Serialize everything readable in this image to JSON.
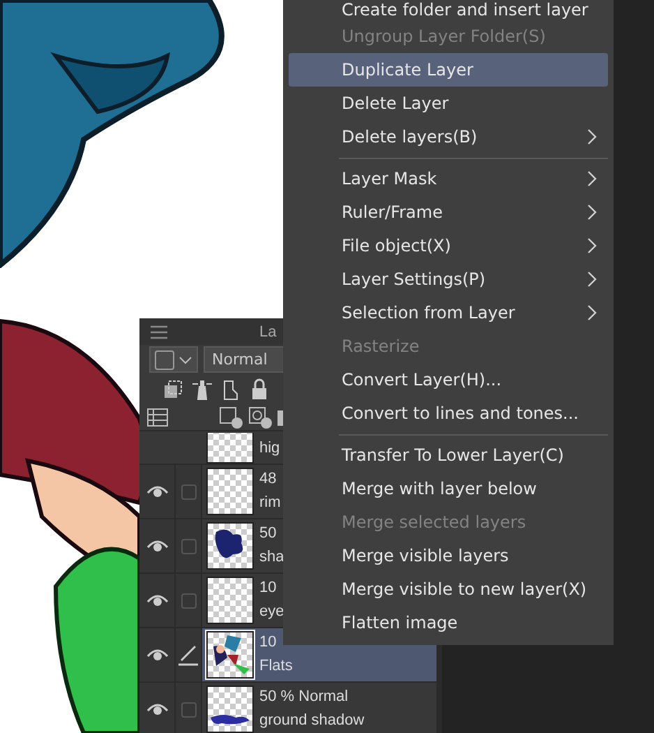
{
  "context_menu": {
    "items": [
      {
        "kind": "item",
        "label": "Create folder and insert layer",
        "disabled": false,
        "selected": false,
        "submenu": false
      },
      {
        "kind": "item",
        "label": "Ungroup Layer Folder(S)",
        "disabled": true,
        "selected": false,
        "submenu": false
      },
      {
        "kind": "item",
        "label": "Duplicate Layer",
        "disabled": false,
        "selected": true,
        "submenu": false
      },
      {
        "kind": "item",
        "label": "Delete Layer",
        "disabled": false,
        "selected": false,
        "submenu": false
      },
      {
        "kind": "item",
        "label": "Delete layers(B)",
        "disabled": false,
        "selected": false,
        "submenu": true
      },
      {
        "kind": "separator"
      },
      {
        "kind": "item",
        "label": "Layer Mask",
        "disabled": false,
        "selected": false,
        "submenu": true
      },
      {
        "kind": "item",
        "label": "Ruler/Frame",
        "disabled": false,
        "selected": false,
        "submenu": true
      },
      {
        "kind": "item",
        "label": "File object(X)",
        "disabled": false,
        "selected": false,
        "submenu": true
      },
      {
        "kind": "item",
        "label": "Layer Settings(P)",
        "disabled": false,
        "selected": false,
        "submenu": true
      },
      {
        "kind": "item",
        "label": "Selection from Layer",
        "disabled": false,
        "selected": false,
        "submenu": true
      },
      {
        "kind": "item",
        "label": "Rasterize",
        "disabled": true,
        "selected": false,
        "submenu": false
      },
      {
        "kind": "item",
        "label": "Convert Layer(H)...",
        "disabled": false,
        "selected": false,
        "submenu": false
      },
      {
        "kind": "item",
        "label": "Convert to lines and tones...",
        "disabled": false,
        "selected": false,
        "submenu": false
      },
      {
        "kind": "separator"
      },
      {
        "kind": "item",
        "label": "Transfer To Lower Layer(C)",
        "disabled": false,
        "selected": false,
        "submenu": false
      },
      {
        "kind": "item",
        "label": "Merge with layer below",
        "disabled": false,
        "selected": false,
        "submenu": false
      },
      {
        "kind": "item",
        "label": "Merge selected layers",
        "disabled": true,
        "selected": false,
        "submenu": false
      },
      {
        "kind": "item",
        "label": "Merge visible layers",
        "disabled": false,
        "selected": false,
        "submenu": false
      },
      {
        "kind": "item",
        "label": "Merge visible to new layer(X)",
        "disabled": false,
        "selected": false,
        "submenu": false
      },
      {
        "kind": "item",
        "label": "Flatten image",
        "disabled": false,
        "selected": false,
        "submenu": false
      }
    ]
  },
  "layer_panel": {
    "title": "La",
    "blend_mode": "Normal",
    "layers": [
      {
        "kind": "cut",
        "line2": "hig",
        "selected": false
      },
      {
        "kind": "blank",
        "line1": "48",
        "line2": "rim",
        "visible": true,
        "editing": false,
        "selected": false
      },
      {
        "kind": "shadow-art",
        "line1": "50",
        "line2": "sha",
        "visible": true,
        "editing": false,
        "selected": false
      },
      {
        "kind": "blank",
        "line1": "10",
        "line2": "eye",
        "visible": true,
        "editing": false,
        "selected": false
      },
      {
        "kind": "flats-art",
        "line1": "10",
        "line2": "Flats",
        "visible": true,
        "editing": true,
        "selected": true
      },
      {
        "kind": "ground-art",
        "line1": "50 % Normal",
        "line2": "ground shadow",
        "visible": true,
        "editing": false,
        "selected": false
      }
    ]
  }
}
